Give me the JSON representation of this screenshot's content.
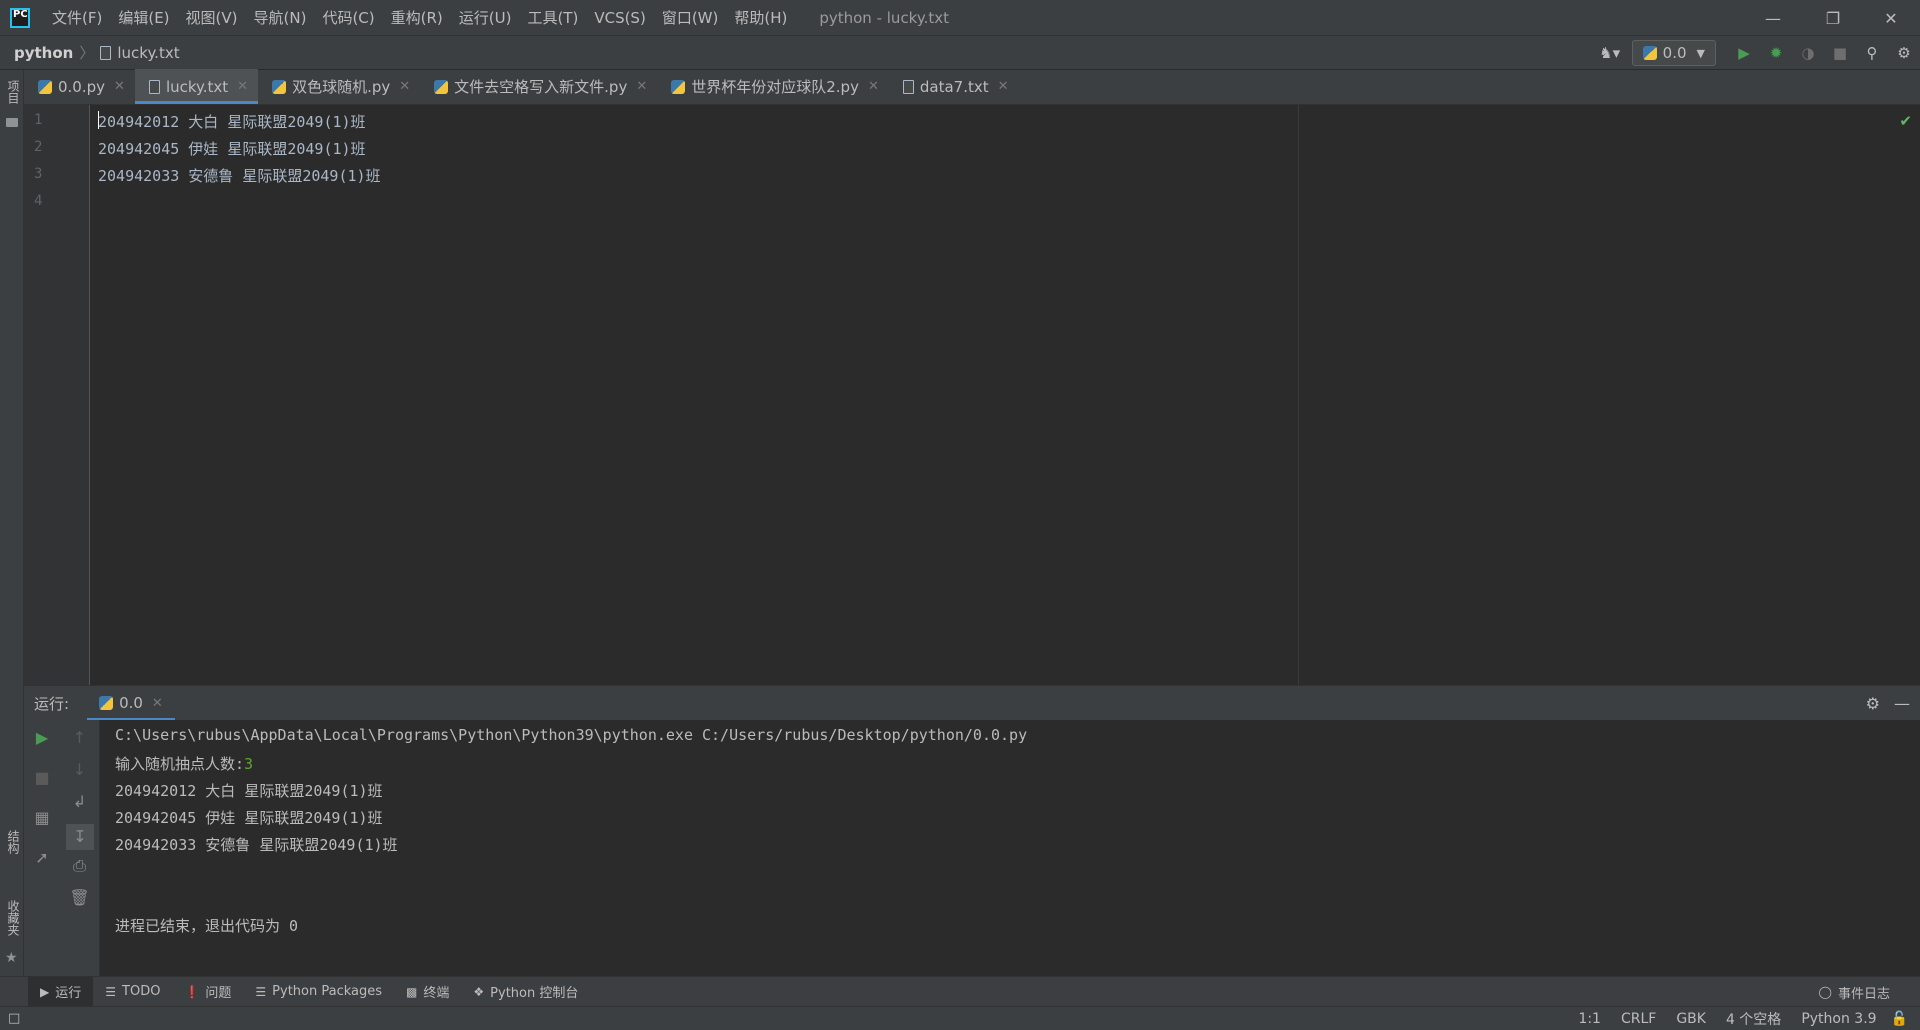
{
  "menubar": {
    "items": [
      "文件(F)",
      "编辑(E)",
      "视图(V)",
      "导航(N)",
      "代码(C)",
      "重构(R)",
      "运行(U)",
      "工具(T)",
      "VCS(S)",
      "窗口(W)",
      "帮助(H)"
    ],
    "window_title": "python - lucky.txt"
  },
  "navbar": {
    "project": "python",
    "file": "lucky.txt",
    "run_config": "0.0"
  },
  "left_strip": {
    "project_label": "项目",
    "structure_label": "结构",
    "favorites_label": "收藏夹"
  },
  "tabs": [
    {
      "label": "0.0.py",
      "type": "py"
    },
    {
      "label": "lucky.txt",
      "type": "txt"
    },
    {
      "label": "双色球随机.py",
      "type": "py"
    },
    {
      "label": "文件去空格写入新文件.py",
      "type": "py"
    },
    {
      "label": "世界杯年份对应球队2.py",
      "type": "py"
    },
    {
      "label": "data7.txt",
      "type": "txt"
    }
  ],
  "editor": {
    "line_numbers": [
      "1",
      "2",
      "3",
      "4"
    ],
    "lines": [
      "204942012 大白 星际联盟2049(1)班",
      "204942045 伊娃 星际联盟2049(1)班",
      "204942033 安德鲁 星际联盟2049(1)班",
      ""
    ]
  },
  "run_panel": {
    "title": "运行:",
    "tab_label": "0.0",
    "console": {
      "command": "C:\\Users\\rubus\\AppData\\Local\\Programs\\Python\\Python39\\python.exe C:/Users/rubus/Desktop/python/0.0.py",
      "prompt": "输入随机抽点人数:",
      "input_value": "3",
      "output": [
        "204942012 大白 星际联盟2049(1)班",
        "204942045 伊娃 星际联盟2049(1)班",
        "204942033 安德鲁 星际联盟2049(1)班"
      ],
      "exit_message": "进程已结束，退出代码为 0"
    }
  },
  "bottom_tools": {
    "run": "运行",
    "todo": "TODO",
    "problems": "问题",
    "python_packages": "Python Packages",
    "terminal": "终端",
    "python_console": "Python 控制台",
    "event_log": "事件日志"
  },
  "statusbar": {
    "position": "1:1",
    "line_separator": "CRLF",
    "encoding": "GBK",
    "indent": "4 个空格",
    "interpreter": "Python 3.9"
  },
  "colors": {
    "accent": "#4a88c7",
    "run_green": "#499c54",
    "input_green": "#62a52d",
    "background": "#2b2b2b",
    "panel": "#3c3f41"
  }
}
